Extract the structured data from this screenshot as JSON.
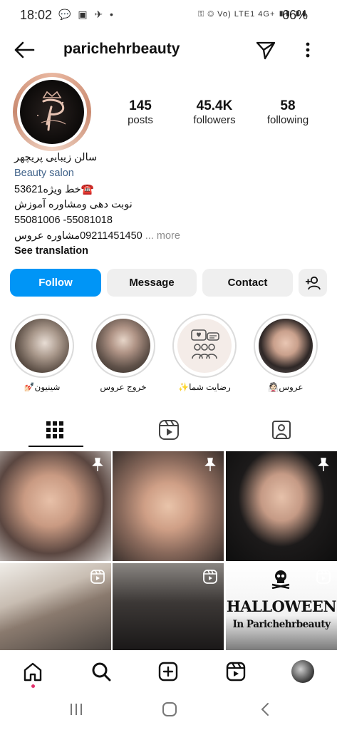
{
  "status": {
    "time": "18:02",
    "left_icons": "💬 ▣ ✈ •",
    "right_icons": "⚿ ◎ Vo) LTE1 4G+ ▮▮ ▮▮",
    "battery": "66%"
  },
  "header": {
    "username": "parichehrbeauty"
  },
  "stats": {
    "posts_num": "145",
    "posts_label": "posts",
    "followers_num": "45.4K",
    "followers_label": "followers",
    "following_num": "58",
    "following_label": "following"
  },
  "bio": {
    "name": "سالن زیبایی پریچهر",
    "category": "Beauty salon",
    "line1": "☎️خط ویژه53621",
    "line2": "نوبت دهی ومشاوره آموزش",
    "line3": "55081006 -55081018",
    "line4": "09211451450مشاوره عروس",
    "more": "... more",
    "see_translation": "See translation"
  },
  "buttons": {
    "follow": "Follow",
    "message": "Message",
    "contact": "Contact"
  },
  "highlights": [
    {
      "label": "شینیون💅🏻"
    },
    {
      "label": "خروج عروس"
    },
    {
      "label": "رضایت شما✨"
    },
    {
      "label": "عروس👰🏻"
    }
  ],
  "grid": {
    "halloween_line1": "HALLOWEEN",
    "halloween_line2": "In Parichehrbeauty"
  },
  "icons": {
    "grid": "grid-icon",
    "reels": "reels-icon",
    "tagged": "tagged-icon",
    "home": "home-icon",
    "search": "search-icon",
    "create": "create-icon",
    "pin": "pin-icon"
  },
  "colors": {
    "follow_blue": "#0095f6",
    "category_blue": "#41638a"
  }
}
